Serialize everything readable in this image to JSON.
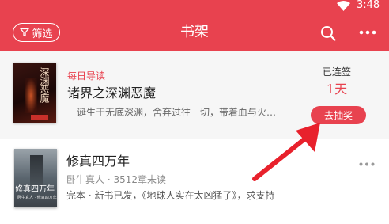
{
  "status_bar": {
    "time": "3:48",
    "wifi_icon": "wifi-icon"
  },
  "header": {
    "background": "#e8424f",
    "filter_label": "筛选",
    "filter_icon": "filter-icon",
    "title": "书架",
    "search_icon": "search-icon",
    "more_icon": "more-horizontal-icon"
  },
  "featured": {
    "cover_title": "深渊恶魔",
    "tag": "每日导读",
    "title": "诸界之深渊恶魔",
    "description": "诞生于无底深渊，舍弃过往一切，带着血与火…",
    "streak_label": "已连签",
    "streak_days": "1天",
    "lottery_button": "去抽奖"
  },
  "books": [
    {
      "cover_title": "修真四万年",
      "cover_subtitle": "卧牛真人 · 修真四万年",
      "title": "修真四万年",
      "meta": "卧牛真人 · 3512章未读",
      "description": "完本 · 新书已发，《地球人实在太凶猛了》，求支持",
      "more_icon": "more-horizontal-icon"
    }
  ],
  "annotation": {
    "color": "#e8212c",
    "icon": "arrow-icon"
  }
}
